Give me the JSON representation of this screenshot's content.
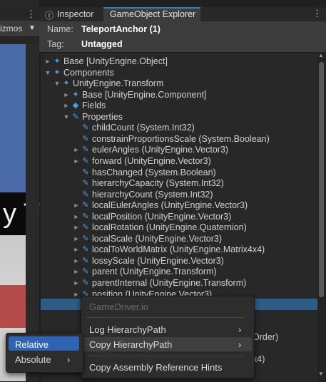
{
  "left": {
    "gizmos_label": "izmos",
    "scene_text": "y T"
  },
  "tabs": {
    "inspector": "Inspector",
    "explorer": "GameObject Explorer"
  },
  "header": {
    "name_label": "Name:",
    "name_value": "TeleportAnchor (1)",
    "tag_label": "Tag:",
    "tag_value": "Untagged"
  },
  "tree": [
    {
      "label": "Base [UnityEngine.Object]",
      "tri": "►",
      "icon": "puzzle"
    },
    {
      "label": "Components",
      "tri": "▼",
      "icon": "puzzle"
    },
    {
      "label": "UnityEngine.Transform",
      "tri": "▼",
      "icon": "puzzle"
    },
    {
      "label": "Base [UnityEngine.Component]",
      "tri": "►",
      "icon": "puzzle"
    },
    {
      "label": "Fields",
      "tri": "►",
      "icon": "cube"
    },
    {
      "label": "Properties",
      "tri": "▼",
      "icon": "wrench"
    },
    {
      "label": "childCount (System.Int32)",
      "tri": "",
      "icon": "wrench"
    },
    {
      "label": "constrainProportionsScale (System.Boolean)",
      "tri": "",
      "icon": "wrench"
    },
    {
      "label": "eulerAngles (UnityEngine.Vector3)",
      "tri": "►",
      "icon": "wrench"
    },
    {
      "label": "forward (UnityEngine.Vector3)",
      "tri": "►",
      "icon": "wrench"
    },
    {
      "label": "hasChanged (System.Boolean)",
      "tri": "",
      "icon": "wrench"
    },
    {
      "label": "hierarchyCapacity (System.Int32)",
      "tri": "",
      "icon": "wrench"
    },
    {
      "label": "hierarchyCount (System.Int32)",
      "tri": "",
      "icon": "wrench"
    },
    {
      "label": "localEulerAngles (UnityEngine.Vector3)",
      "tri": "►",
      "icon": "wrench"
    },
    {
      "label": "localPosition (UnityEngine.Vector3)",
      "tri": "►",
      "icon": "wrench"
    },
    {
      "label": "localRotation (UnityEngine.Quaternion)",
      "tri": "►",
      "icon": "wrench"
    },
    {
      "label": "localScale (UnityEngine.Vector3)",
      "tri": "►",
      "icon": "wrench"
    },
    {
      "label": "localToWorldMatrix (UnityEngine.Matrix4x4)",
      "tri": "►",
      "icon": "wrench"
    },
    {
      "label": "lossyScale (UnityEngine.Vector3)",
      "tri": "►",
      "icon": "wrench"
    },
    {
      "label": "parent (UnityEngine.Transform)",
      "tri": "►",
      "icon": "wrench"
    },
    {
      "label": "parentInternal (UnityEngine.Transform)",
      "tri": "►",
      "icon": "wrench"
    },
    {
      "label": "position (UnityEngine.Vector3)",
      "tri": "►",
      "icon": "wrench"
    }
  ],
  "behind_menu": {
    "order": "Order)",
    "matrix": "x4)"
  },
  "context_menu": {
    "header": "GameDriver.io",
    "log_hierarchy_path": "Log HierarchyPath",
    "copy_hierarchy_path": "Copy HierarchyPath",
    "copy_assembly_hints": "Copy Assembly Reference Hints"
  },
  "submenu": {
    "relative": "Relative",
    "absolute": "Absolute"
  },
  "colors": {
    "selection": "#2c5d87",
    "menu_highlight": "#2f64b4",
    "icon_blue": "#4c9fe0"
  }
}
